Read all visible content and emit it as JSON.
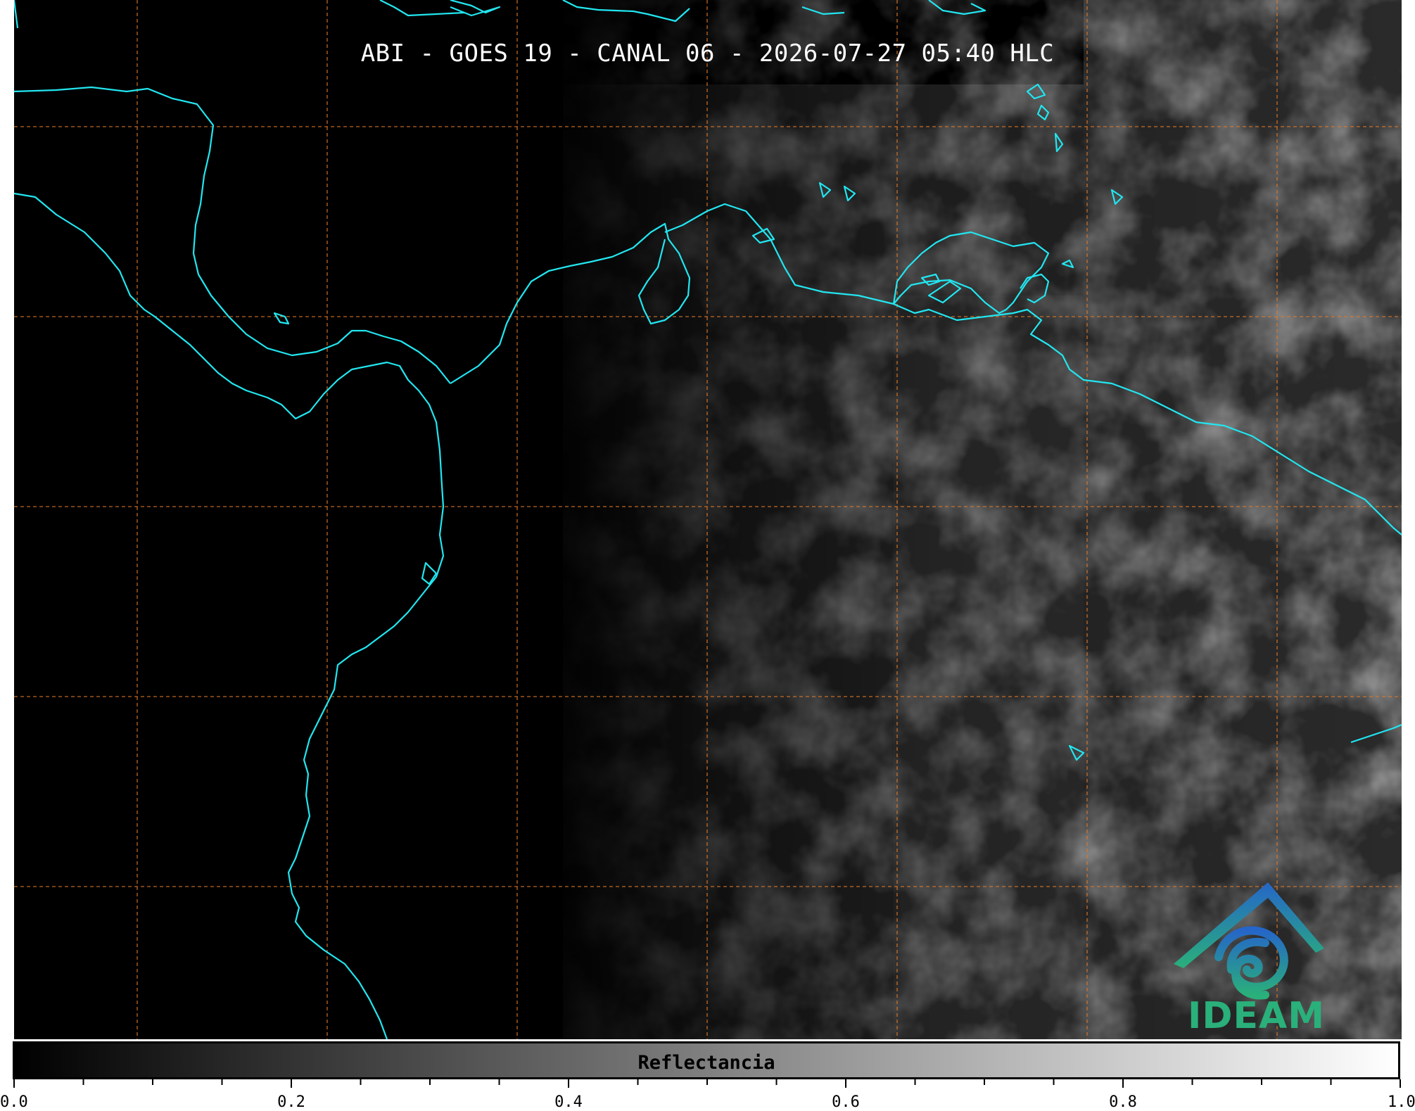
{
  "title": "ABI - GOES 19 - CANAL 06 - 2026-07-27 05:40 HLC",
  "colorbar": {
    "label": "Reflectancia",
    "ticks": [
      "0.0",
      "0.2",
      "0.4",
      "0.6",
      "0.8",
      "1.0"
    ],
    "range": [
      0.0,
      1.0
    ],
    "colormap": [
      "#000000",
      "#ffffff"
    ]
  },
  "logo": {
    "text": "IDEAM"
  },
  "colors": {
    "coastline": "#22e6f0",
    "gridlines": "#e07a2a",
    "background": "#000000"
  }
}
